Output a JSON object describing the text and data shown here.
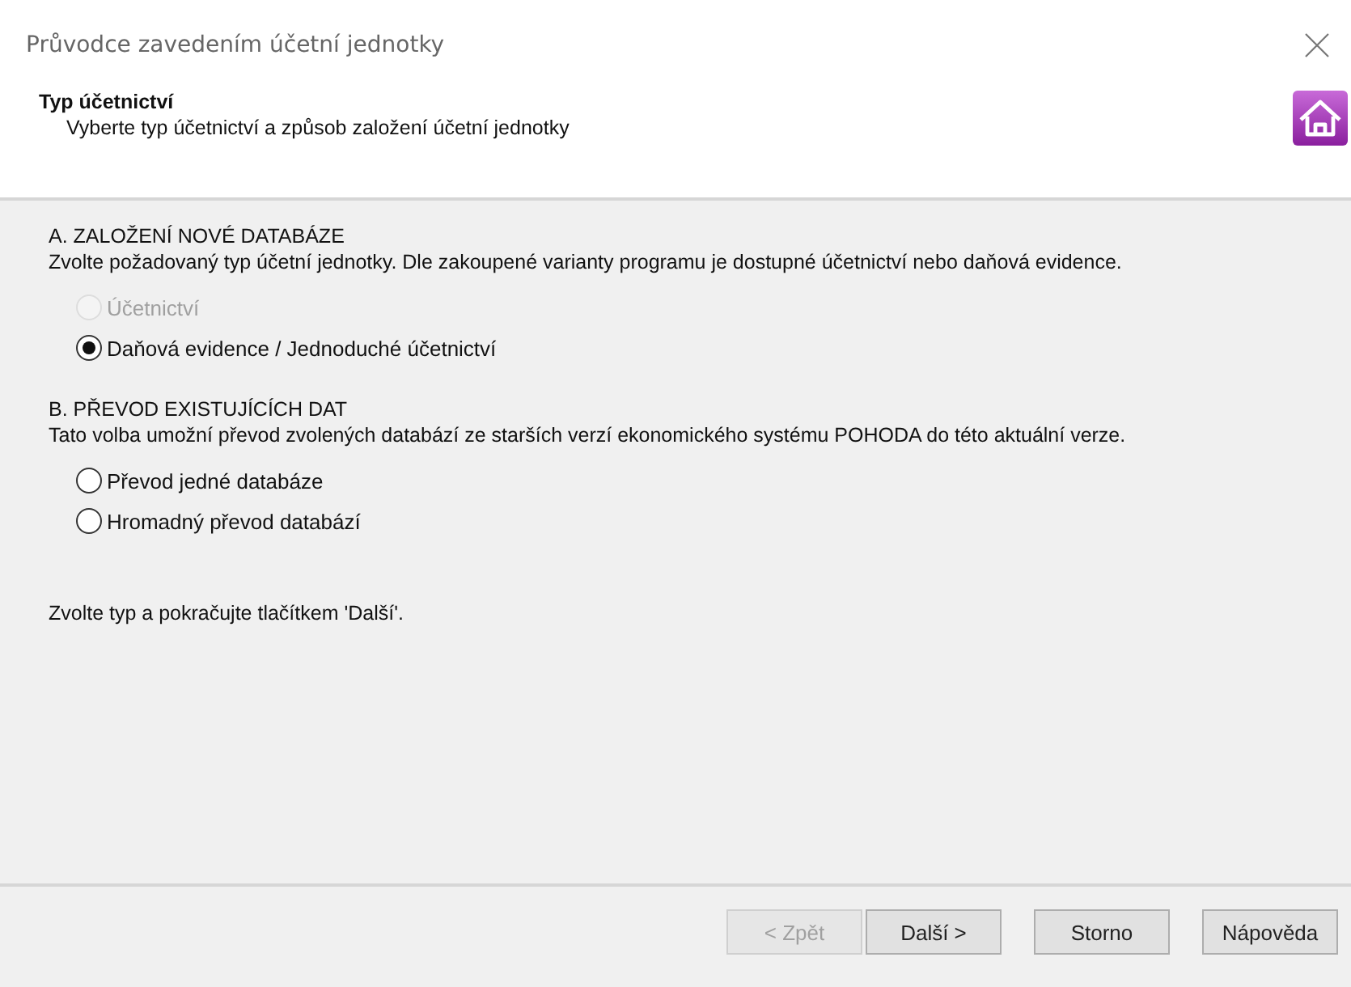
{
  "window": {
    "title": "Průvodce zavedením účetní jednotky"
  },
  "header": {
    "title": "Typ účetnictví",
    "subtitle": "Vyberte typ účetnictví a způsob založení účetní jednotky"
  },
  "sections": [
    {
      "heading": "A. ZALOŽENÍ NOVÉ DATABÁZE",
      "description": "Zvolte požadovaný typ účetní jednotky. Dle zakoupené varianty programu je dostupné účetnictví nebo daňová evidence.",
      "options": [
        {
          "label": "Účetnictví",
          "selected": false,
          "disabled": true
        },
        {
          "label": "Daňová evidence / Jednoduché účetnictví",
          "selected": true,
          "disabled": false
        }
      ]
    },
    {
      "heading": "B. PŘEVOD EXISTUJÍCÍCH DAT",
      "description": "Tato volba umožní převod zvolených databází ze starších verzí ekonomického systému POHODA do této aktuální verze.",
      "options": [
        {
          "label": "Převod jedné databáze",
          "selected": false,
          "disabled": false
        },
        {
          "label": "Hromadný převod databází",
          "selected": false,
          "disabled": false
        }
      ]
    }
  ],
  "hint": "Zvolte typ a pokračujte tlačítkem 'Další'.",
  "buttons": [
    {
      "label": "< Zpět",
      "disabled": true
    },
    {
      "label": "Další >",
      "disabled": false
    },
    {
      "label": "Storno",
      "disabled": false
    },
    {
      "label": "Nápověda",
      "disabled": false
    }
  ]
}
